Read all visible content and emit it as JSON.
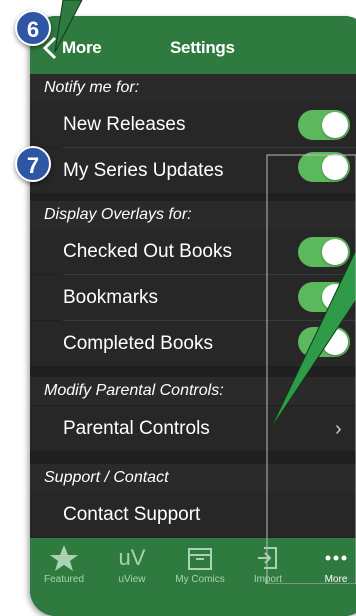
{
  "navbar": {
    "back_label": "More",
    "title": "Settings"
  },
  "sections": {
    "notify": {
      "header": "Notify me for:",
      "items": [
        "New Releases",
        "My Series Updates"
      ]
    },
    "overlays": {
      "header": "Display Overlays for:",
      "items": [
        "Checked Out Books",
        "Bookmarks",
        "Completed Books"
      ]
    },
    "parental": {
      "header": "Modify Parental Controls:",
      "items": [
        "Parental Controls"
      ]
    },
    "support": {
      "header": "Support / Contact",
      "items": [
        "Contact Support"
      ]
    }
  },
  "toggles": {
    "new_releases": true,
    "my_series_updates": true,
    "checked_out_books": true,
    "bookmarks": true,
    "completed_books": true
  },
  "tabs": [
    {
      "label": "Featured",
      "icon": "star-icon"
    },
    {
      "label": "uView",
      "icon": "uview-icon"
    },
    {
      "label": "My Comics",
      "icon": "box-icon"
    },
    {
      "label": "Import",
      "icon": "import-icon"
    },
    {
      "label": "More",
      "icon": "more-dots-icon"
    }
  ],
  "callouts": {
    "one": "6",
    "two": "7"
  },
  "colors": {
    "accent_green": "#2f7a3e",
    "toggle_green": "#5bb85c",
    "badge_blue": "#2e56a5",
    "cell_bg": "#272727"
  }
}
